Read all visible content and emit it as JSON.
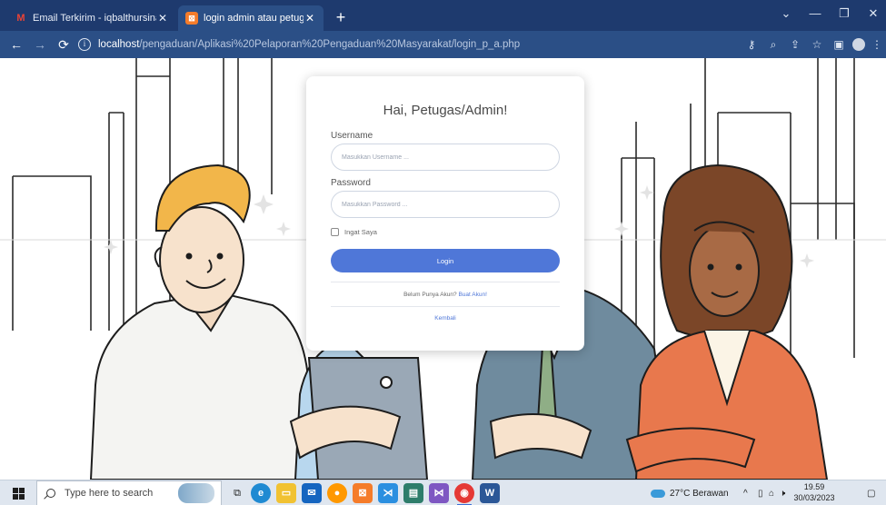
{
  "browser": {
    "tabs": [
      {
        "title": "Email Terkirim - iqbalthursina@g",
        "icon": "gmail-icon",
        "active": false
      },
      {
        "title": "login admin atau petugas",
        "icon": "xampp-icon",
        "active": true
      }
    ],
    "new_tab_label": "+",
    "url_host": "localhost",
    "url_path": "/pengaduan/Aplikasi%20Pelaporan%20Pengaduan%20Masyarakat/login_p_a.php"
  },
  "login": {
    "title": "Hai, Petugas/Admin!",
    "username_label": "Username",
    "username_placeholder": "Masukkan Username ...",
    "password_label": "Password",
    "password_placeholder": "Masukkan Password ...",
    "remember_label": "Ingat Saya",
    "login_button": "Login",
    "register_text": "Belum Punya Akun?",
    "register_link": "Buat Akun!",
    "back_link": "Kembali",
    "accent_color": "#4f77d8"
  },
  "taskbar": {
    "search_placeholder": "Type here to search",
    "weather": "27°C  Berawan",
    "time": "19.59",
    "date": "30/03/2023"
  }
}
